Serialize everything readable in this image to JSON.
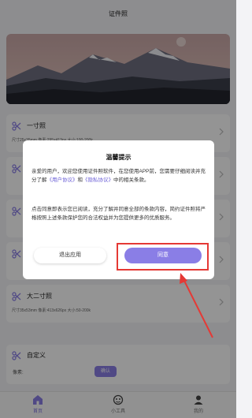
{
  "header": {
    "title": "证件照"
  },
  "specs": [
    {
      "name": "一寸照",
      "meta": "尺寸25x35mm 像素:295x413px 大小:100-200k"
    },
    {
      "name": "",
      "meta": ""
    },
    {
      "name": "",
      "meta": ""
    },
    {
      "name": "",
      "meta": ""
    },
    {
      "name": "",
      "meta": ""
    },
    {
      "name": "大二寸照",
      "meta": "尺寸35x53mm 像素:413x626px 大小:50-200k"
    }
  ],
  "custom": {
    "name": "自定义",
    "pixel_label": "像素:",
    "confirm_label": "确认"
  },
  "tabbar": {
    "tabs": [
      {
        "label": "首页",
        "icon": "home-icon",
        "active": true
      },
      {
        "label": "小工具",
        "icon": "tools-icon",
        "active": false
      },
      {
        "label": "我的",
        "icon": "user-icon",
        "active": false
      }
    ]
  },
  "dialog": {
    "title": "温馨提示",
    "para1_part1": "亲爱的用户，欢迎您使用证件照软件，在您使用APP前，您需要仔细阅读并充分了解",
    "privacy_user_link": "《用户协议》",
    "and_text": "和",
    "privacy_policy_link": "《隐私协议》",
    "para1_part2": "中的相关条款。",
    "para2": "点击同意即表示您已阅读，充分了解并同意全部的条款内容，简约证件照将严格按照上述条款保护您的合法权益并为您提供更多的优质服务。",
    "exit_label": "退出应用",
    "agree_label": "同意"
  },
  "colors": {
    "accent": "#8a7ee6",
    "annotation_red": "#e53935"
  }
}
